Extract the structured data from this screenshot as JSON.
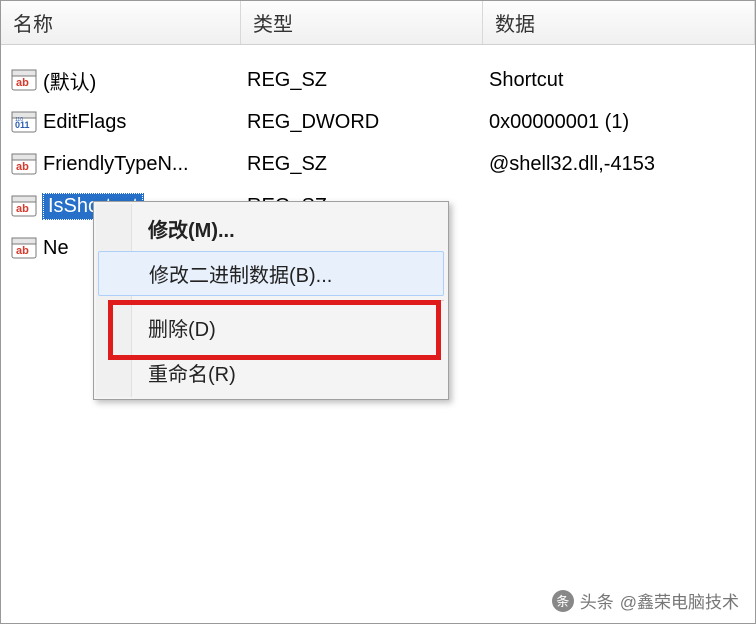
{
  "headers": {
    "name": "名称",
    "type": "类型",
    "data": "数据"
  },
  "rows": [
    {
      "name": "(默认)",
      "type": "REG_SZ",
      "data": "Shortcut",
      "icon": "sz",
      "selected": false
    },
    {
      "name": "EditFlags",
      "type": "REG_DWORD",
      "data": "0x00000001 (1)",
      "icon": "dword",
      "selected": false
    },
    {
      "name": "FriendlyTypeN...",
      "type": "REG_SZ",
      "data": "@shell32.dll,-4153",
      "icon": "sz",
      "selected": false
    },
    {
      "name": "IsShortcut",
      "type": "REG_SZ",
      "data": "",
      "icon": "sz",
      "selected": true
    },
    {
      "name": "Ne",
      "type": "",
      "data": "",
      "icon": "sz",
      "selected": false
    }
  ],
  "context_menu": {
    "modify": "修改(M)...",
    "modify_binary": "修改二进制数据(B)...",
    "delete": "删除(D)",
    "rename": "重命名(R)"
  },
  "watermark": {
    "prefix": "头条",
    "handle": "@鑫荣电脑技术"
  }
}
